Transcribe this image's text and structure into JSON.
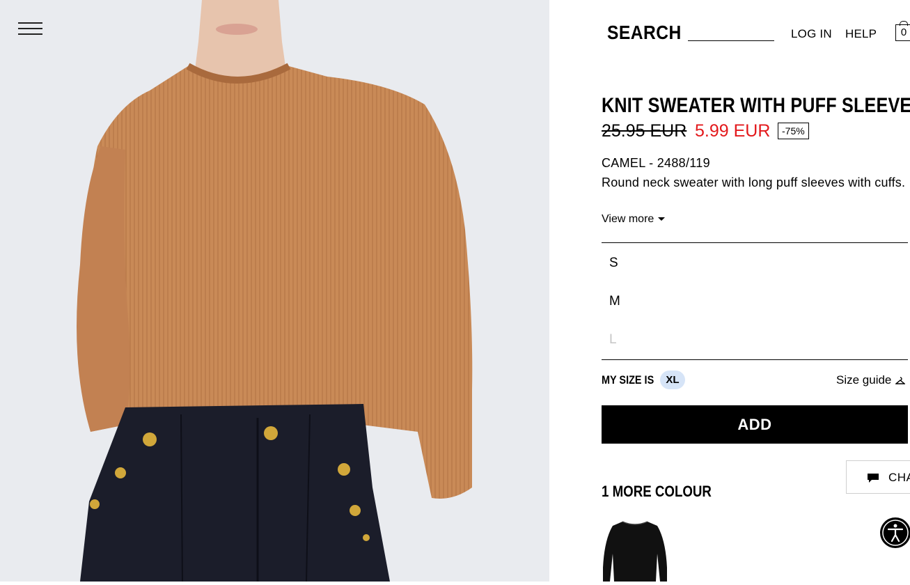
{
  "header": {
    "search_label": "SEARCH",
    "search_placeholder": "",
    "login_label": "LOG IN",
    "help_label": "HELP",
    "cart_count": "0"
  },
  "product": {
    "title": "KNIT SWEATER WITH PUFF SLEEVES",
    "old_price": "25.95 EUR",
    "new_price": "5.99 EUR",
    "discount": "-75%",
    "colour_ref": "CAMEL - 2488/119",
    "description": "Round neck sweater with long puff sleeves with cuffs.",
    "view_more": "View more"
  },
  "sizes": [
    {
      "label": "S",
      "available": true
    },
    {
      "label": "M",
      "available": true
    },
    {
      "label": "L",
      "available": false
    }
  ],
  "my_size": {
    "label": "MY SIZE IS",
    "value": "XL"
  },
  "size_guide_label": "Size guide",
  "add_button_label": "ADD",
  "chat_label": "CHA",
  "more_colour_label": "1 MORE COLOUR",
  "colors": {
    "sale_red": "#e3191c",
    "mysize_badge_bg": "#d6e4f7",
    "sweater": "#c98a57",
    "unavailable_size": "#c5c5c5"
  },
  "icons": {
    "menu": "hamburger-menu-icon",
    "cart": "shopping-bag-icon",
    "size_guide": "hanger-icon",
    "chat": "chat-bubble-icon",
    "accessibility": "accessibility-icon"
  }
}
